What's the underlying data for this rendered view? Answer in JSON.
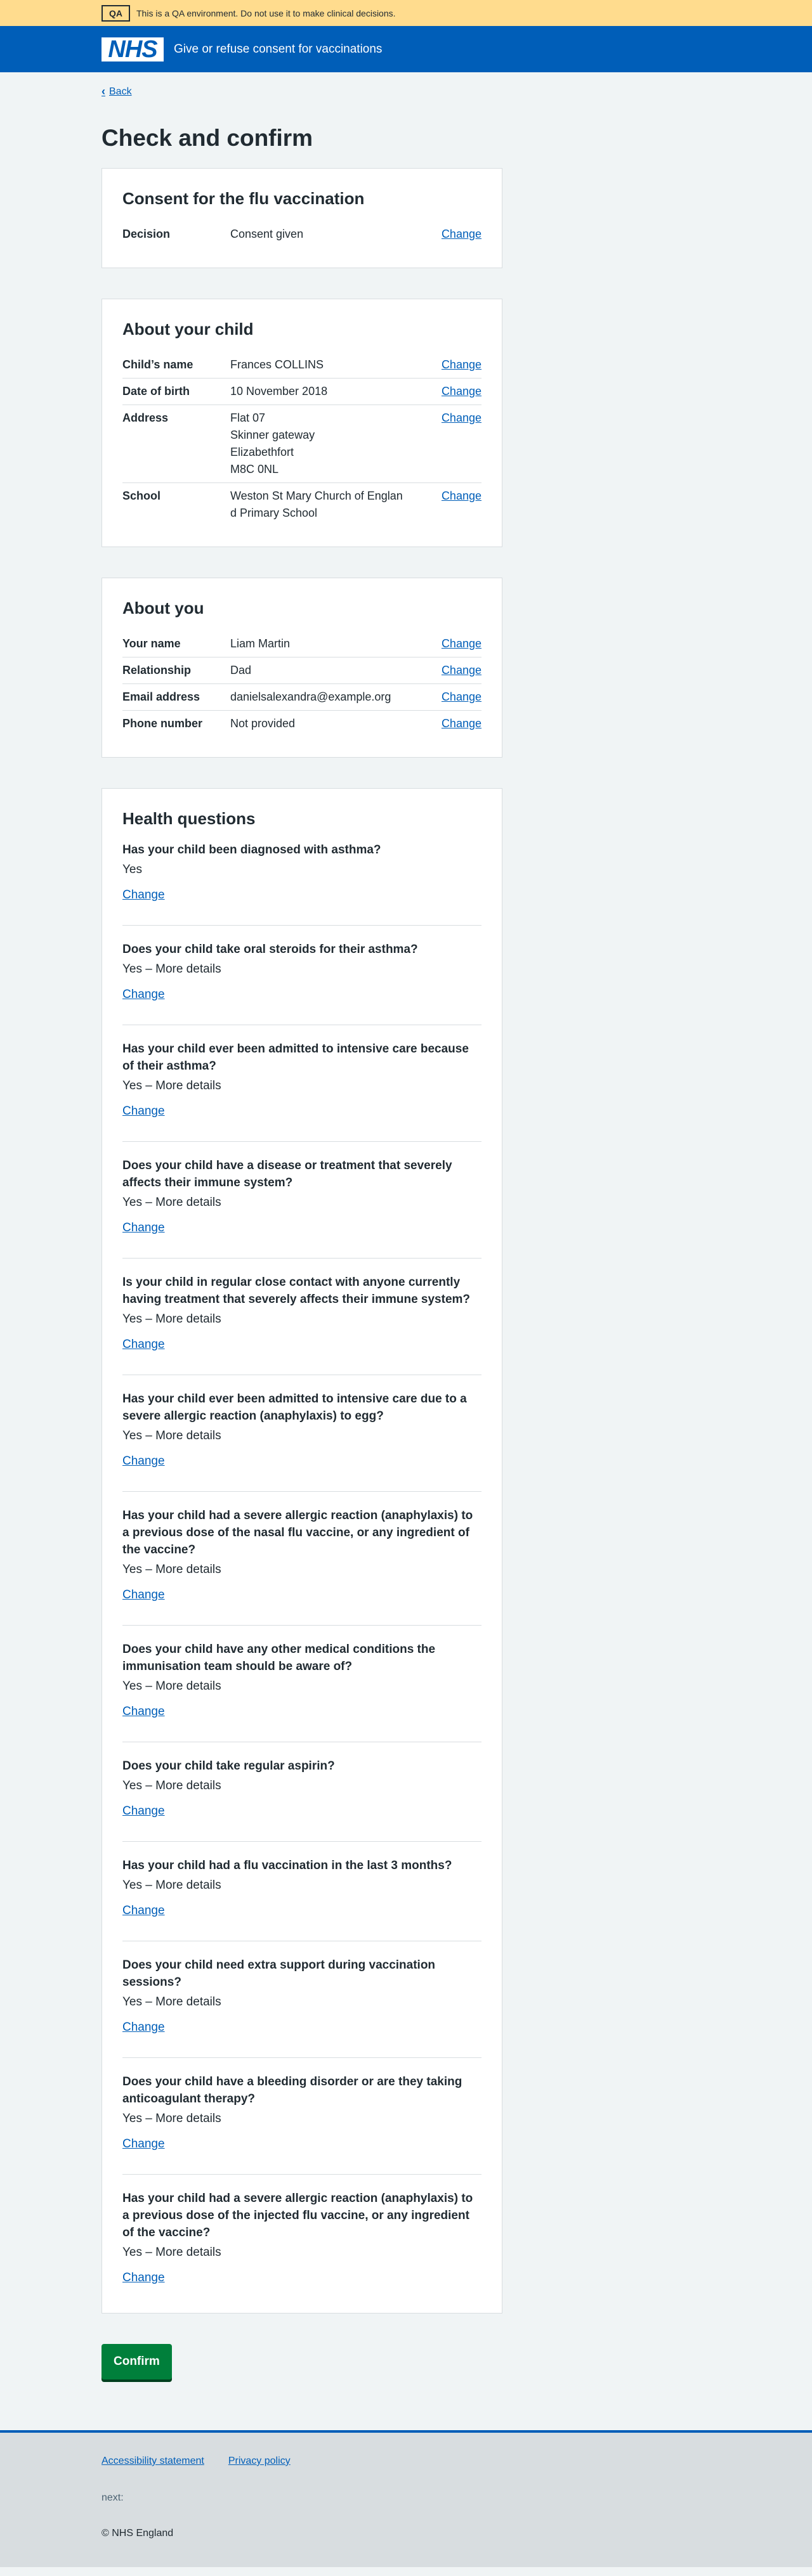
{
  "qa_banner": {
    "tag": "QA",
    "text": "This is a QA environment. Do not use it to make clinical decisions."
  },
  "header": {
    "logo_text": "NHS",
    "service_name": "Give or refuse consent for vaccinations"
  },
  "back_link": "Back",
  "page_title": "Check and confirm",
  "consent": {
    "title": "Consent for the flu vaccination",
    "rows": [
      {
        "key": "Decision",
        "value": [
          "Consent given"
        ],
        "action": "Change"
      }
    ]
  },
  "child": {
    "title": "About your child",
    "rows": [
      {
        "key": "Child’s name",
        "value": [
          "Frances COLLINS"
        ],
        "action": "Change"
      },
      {
        "key": "Date of birth",
        "value": [
          "10 November 2018"
        ],
        "action": "Change"
      },
      {
        "key": "Address",
        "value": [
          "Flat 07",
          "Skinner gateway",
          "Elizabethfort",
          "M8C 0NL"
        ],
        "action": "Change"
      },
      {
        "key": "School",
        "value": [
          "Weston St Mary Church of England Primary School"
        ],
        "action": "Change"
      }
    ]
  },
  "you": {
    "title": "About you",
    "rows": [
      {
        "key": "Your name",
        "value": [
          "Liam Martin"
        ],
        "action": "Change"
      },
      {
        "key": "Relationship",
        "value": [
          "Dad"
        ],
        "action": "Change"
      },
      {
        "key": "Email address",
        "value": [
          "danielsalexandra@example.org"
        ],
        "action": "Change"
      },
      {
        "key": "Phone number",
        "value": [
          "Not provided"
        ],
        "action": "Change"
      }
    ]
  },
  "health": {
    "title": "Health questions",
    "items": [
      {
        "question": "Has your child been diagnosed with asthma?",
        "answer": "Yes",
        "action": "Change"
      },
      {
        "question": "Does your child take oral steroids for their asthma?",
        "answer": "Yes – More details",
        "action": "Change"
      },
      {
        "question": "Has your child ever been admitted to intensive care because of their asthma?",
        "answer": "Yes – More details",
        "action": "Change"
      },
      {
        "question": "Does your child have a disease or treatment that severely affects their immune system?",
        "answer": "Yes – More details",
        "action": "Change"
      },
      {
        "question": "Is your child in regular close contact with anyone currently having treatment that severely affects their immune system?",
        "answer": "Yes – More details",
        "action": "Change"
      },
      {
        "question": "Has your child ever been admitted to intensive care due to a severe allergic reaction (anaphylaxis) to egg?",
        "answer": "Yes – More details",
        "action": "Change"
      },
      {
        "question": "Has your child had a severe allergic reaction (anaphylaxis) to a previous dose of the nasal flu vaccine, or any ingredient of the vaccine?",
        "answer": "Yes – More details",
        "action": "Change"
      },
      {
        "question": "Does your child have any other medical conditions the immunisation team should be aware of?",
        "answer": "Yes – More details",
        "action": "Change"
      },
      {
        "question": "Does your child take regular aspirin?",
        "answer": "Yes – More details",
        "action": "Change"
      },
      {
        "question": "Has your child had a flu vaccination in the last 3 months?",
        "answer": "Yes – More details",
        "action": "Change"
      },
      {
        "question": "Does your child need extra support during vaccination sessions?",
        "answer": "Yes – More details",
        "action": "Change"
      },
      {
        "question": "Does your child have a bleeding disorder or are they taking anticoagulant therapy?",
        "answer": "Yes – More details",
        "action": "Change"
      },
      {
        "question": "Has your child had a severe allergic reaction (anaphylaxis) to a previous dose of the injected flu vaccine, or any ingredient of the vaccine?",
        "answer": "Yes – More details",
        "action": "Change"
      }
    ]
  },
  "confirm_button": "Confirm",
  "footer": {
    "links": [
      "Accessibility statement",
      "Privacy policy"
    ],
    "next_text": "next:",
    "copyright": "© NHS England"
  },
  "colors": {
    "qa_banner": "#ffdc8e",
    "header": "#005eb8",
    "link": "#005eb8",
    "button": "#007f3b",
    "page_bg": "#f0f4f5",
    "footer_bg": "#d8dde0"
  }
}
